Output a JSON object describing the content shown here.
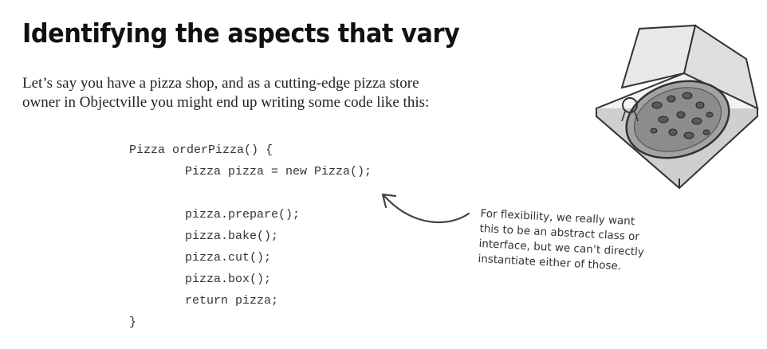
{
  "heading": {
    "title": "Identifying the aspects that vary"
  },
  "intro": {
    "line1": "Let’s say you have a pizza shop, and as a cutting-edge pizza store",
    "line2": "owner in Objectville you might end up writing some code like this:"
  },
  "code": {
    "lines": [
      "Pizza orderPizza() {",
      "Pizza pizza = new Pizza();",
      "pizza.prepare();",
      "pizza.bake();",
      "pizza.cut();",
      "pizza.box();",
      "return pizza;",
      "}"
    ]
  },
  "annotation": {
    "line1": "For flexibility, we really want",
    "line2": "this to be an abstract class or",
    "line3": "interface, but we can’t directly",
    "line4": "instantiate either of those."
  },
  "illustration": {
    "icon": "pizza-box-icon"
  }
}
